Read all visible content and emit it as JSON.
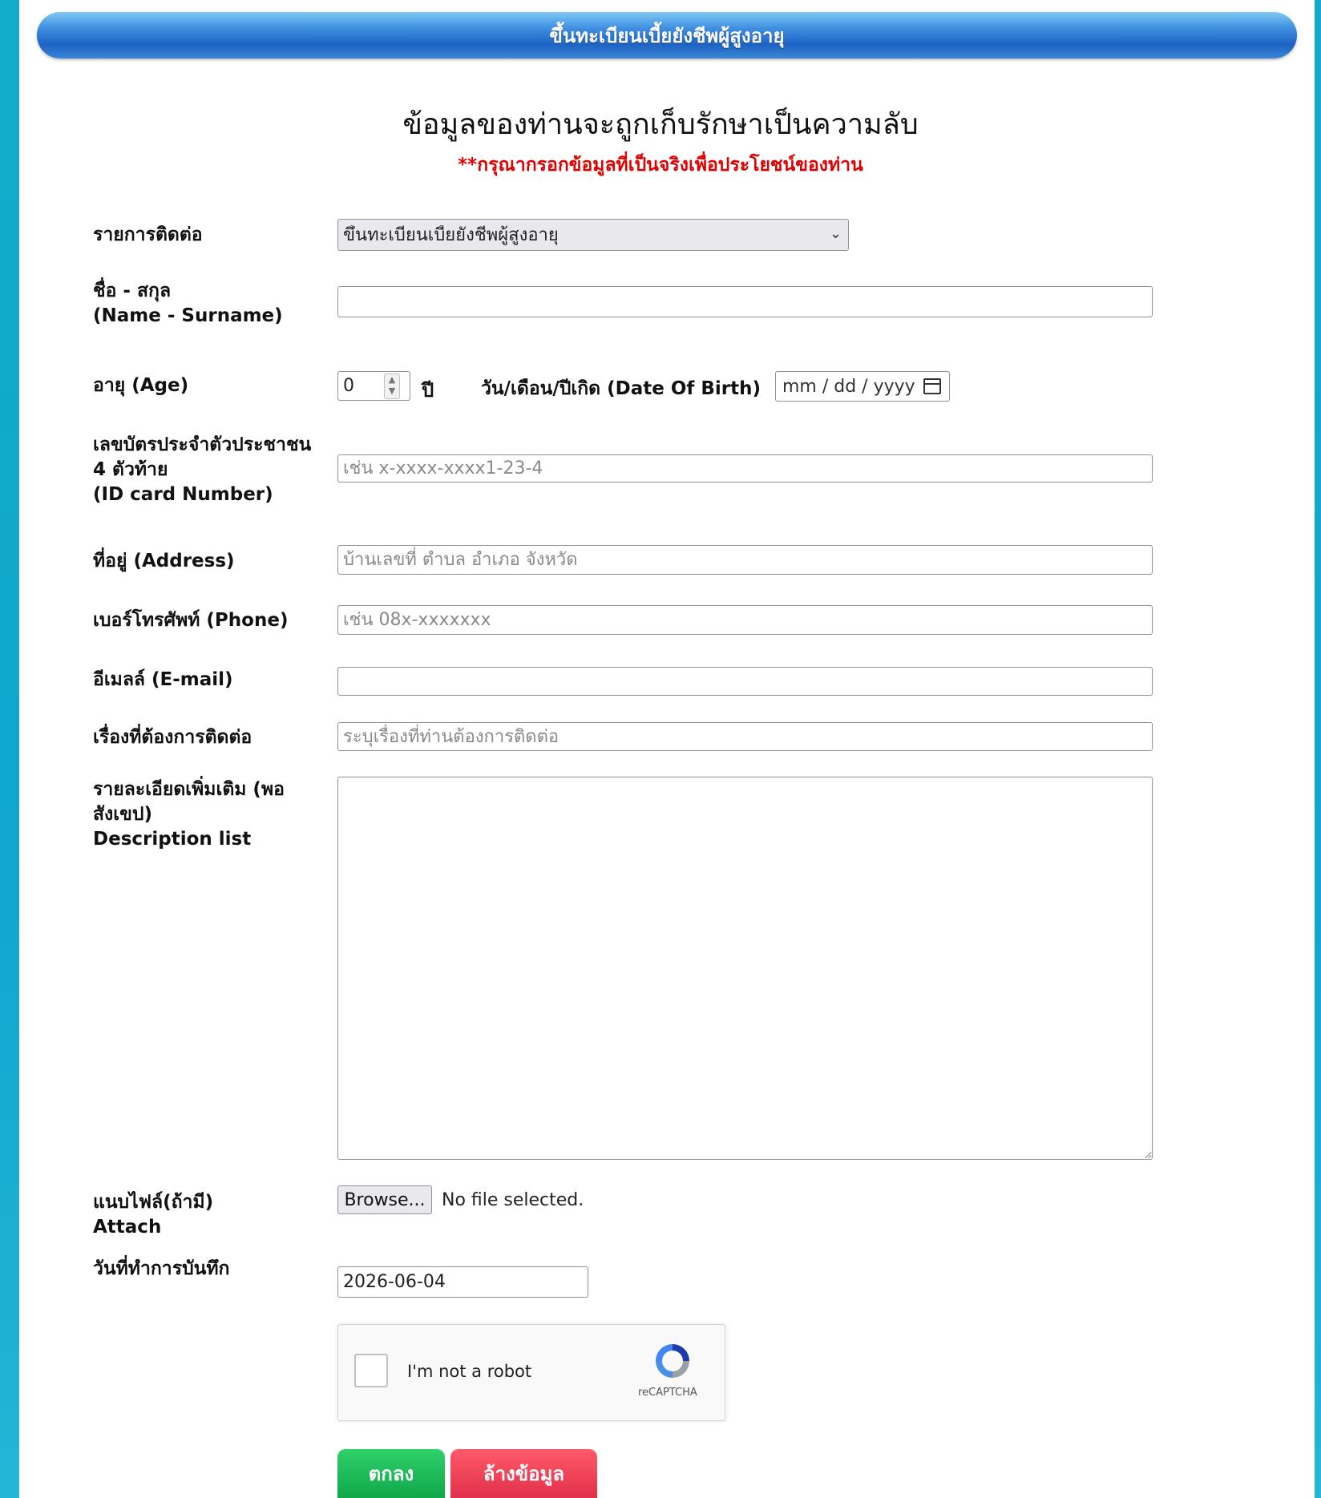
{
  "header": {
    "title": "ขึ้นทะเบียนเบี้ยยังชีพผู้สูงอายุ"
  },
  "intro": {
    "heading": "ข้อมูลของท่านจะถูกเก็บรักษาเป็นความลับ",
    "note": "**กรุณากรอกข้อมูลที่เป็นจริงเพื่อประโยชน์ของท่าน"
  },
  "form": {
    "contact_type": {
      "label": "รายการติดต่อ",
      "selected": "ขึ้นทะเบียนเบี้ยยังชีพผู้สูงอายุ"
    },
    "name": {
      "label_th": "ชื่อ - สกุล",
      "label_en": "(Name - Surname)",
      "value": ""
    },
    "age": {
      "label": "อายุ (Age)",
      "value": "0",
      "unit": "ปี"
    },
    "dob": {
      "label": "วัน/เดือน/ปีเกิด (Date Of Birth)",
      "placeholder": "mm / dd / yyyy"
    },
    "id_card": {
      "label_th": "เลขบัตรประจำตัวประชาชน",
      "label_th2": "4 ตัวท้าย",
      "label_en": "(ID card Number)",
      "placeholder": "เช่น x-xxxx-xxxx1-23-4"
    },
    "address": {
      "label": "ที่อยู่ (Address)",
      "placeholder": "บ้านเลขที่ ตำบล อำเภอ จังหวัด"
    },
    "phone": {
      "label": "เบอร์โทรศัพท์ (Phone)",
      "placeholder": "เช่น 08x-xxxxxxx"
    },
    "email": {
      "label": "อีเมลล์ (E-mail)",
      "value": ""
    },
    "subject": {
      "label": "เรื่องที่ต้องการติดต่อ",
      "placeholder": "ระบุเรื่องที่ท่านต้องการติดต่อ"
    },
    "description": {
      "label_th": "รายละเอียดเพิ่มเติม (พอ",
      "label_th2": "สังเขป)",
      "label_en": "Description list",
      "value": ""
    },
    "attach": {
      "label_th": "แนบไฟล์(ถ้ามี)",
      "label_en": "Attach",
      "browse_label": "Browse...",
      "status": "No file selected."
    },
    "record_date": {
      "label": "วันที่ทำการบันทึก",
      "value": "2026-06-04"
    }
  },
  "captcha": {
    "text": "I'm not a robot",
    "brand": "reCAPTCHA"
  },
  "buttons": {
    "submit": "ตกลง",
    "clear": "ล้างข้อมูล"
  },
  "colors": {
    "accent_blue": "#1d63c4",
    "note_red": "#e00000",
    "ok_green": "#11a84a",
    "clear_red": "#e0304a",
    "frame_teal": "#12acc8"
  }
}
